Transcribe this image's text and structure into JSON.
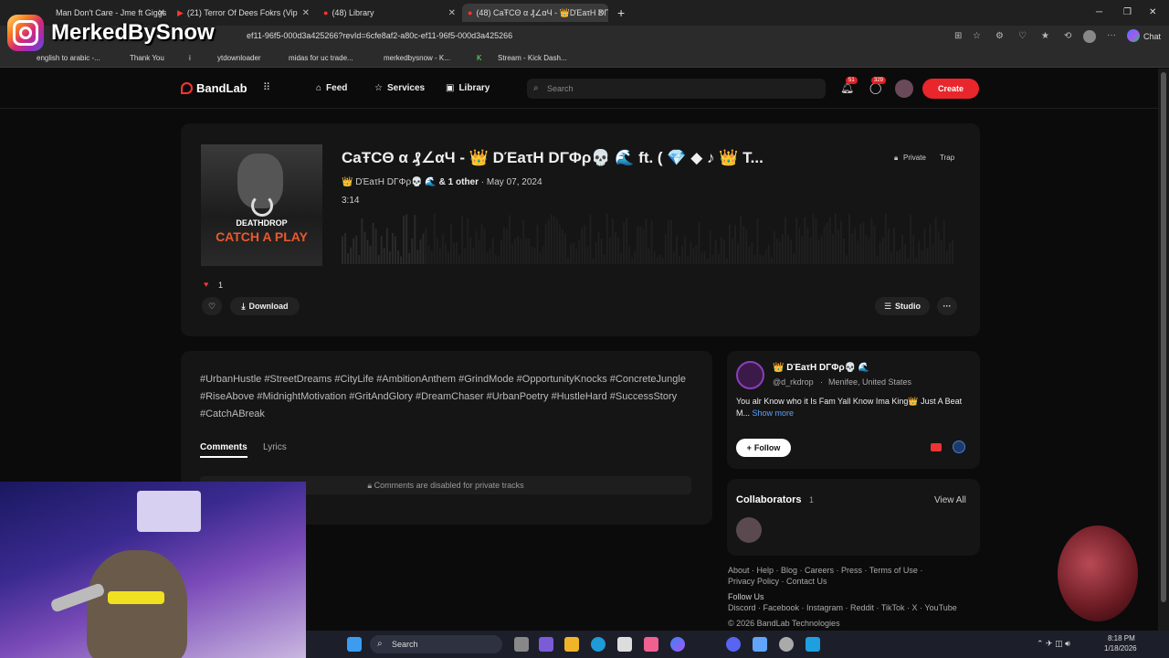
{
  "browser": {
    "tabs": [
      {
        "label": "Man Don't Care - Jme ft Giggs",
        "active": false
      },
      {
        "label": "(21) Terror Of Dees Fokrs (Vip",
        "active": false
      },
      {
        "label": "(48) Library",
        "active": false
      },
      {
        "label": "(48) CaŦCΘ α ₰∠αЧ - 👑DΈaτH DΓΦρ",
        "active": true
      }
    ],
    "url": "ef11-96f5-000d3a425266?revId=6cfe8af2-a80c-ef11-96f5-000d3a425266",
    "chat_label": "Chat",
    "bookmarks": [
      "english to arabic -...",
      "Thank You",
      "i",
      "ytdownloader",
      "midas for uc trade...",
      "merkedbysnow - K...",
      "Stream - Kick Dash..."
    ]
  },
  "overlay": {
    "instagram_handle": "MerkedBySnow"
  },
  "header": {
    "logo": "BandLab",
    "nav": [
      {
        "label": "Feed",
        "icon": "home-icon"
      },
      {
        "label": "Services",
        "icon": "star-icon"
      },
      {
        "label": "Library",
        "icon": "library-icon"
      }
    ],
    "search_placeholder": "Search",
    "notifications_count": "51",
    "messages_count": "329",
    "create_label": "Create"
  },
  "track": {
    "cover_artist": "DEATHDROP",
    "cover_title": "CATCH A PLAY",
    "title": "CaŦCΘ α ₰∠αЧ - 👑 DΈaτH DΓΦρ💀 🌊 ft. ( 💎 ◆ ♪ 👑 T...",
    "privacy": "Private",
    "genre": "Trap",
    "artist": "👑 DΈaτH DΓΦρ💀 🌊",
    "others": "& 1 other",
    "date": "May 07, 2024",
    "duration": "3:14",
    "likes": "1",
    "download_label": "Download",
    "studio_label": "Studio",
    "more_label": "···"
  },
  "description": {
    "hashtags": "#UrbanHustle #StreetDreams #CityLife #AmbitionAnthem #GrindMode #OpportunityKnocks #ConcreteJungle #RiseAbove #MidnightMotivation #GritAndGlory #DreamChaser #UrbanPoetry #HustleHard #SuccessStory #CatchABreak",
    "tabs": [
      "Comments",
      "Lyrics"
    ],
    "comments_disabled": "Comments are disabled for private tracks"
  },
  "profile": {
    "name": "👑 DΈaτH DΓΦρ💀 🌊",
    "handle": "@d_rkdrop",
    "location": "Menifee, United States",
    "bio": "You alr Know who it Is Fam Yall Know Ima King👑 Just A Beat M...",
    "show_more": "Show more",
    "follow_label": "Follow"
  },
  "collaborators": {
    "title": "Collaborators",
    "count": "1",
    "view_all": "View All"
  },
  "footer": {
    "links_row1": "About · Help · Blog · Careers · Press · Terms of Use ·",
    "links_row2": "Privacy Policy · Contact Us",
    "follow_us": "Follow Us",
    "social": "Discord · Facebook · Instagram · Reddit · TikTok · X · YouTube",
    "copyright": "© 2026 BandLab Technologies"
  },
  "taskbar": {
    "search_label": "Search",
    "time": "8:18 PM",
    "date": "1/18/2026"
  },
  "colors": {
    "accent": "#e8262c",
    "background": "#0b0b0b",
    "card": "#151515"
  }
}
